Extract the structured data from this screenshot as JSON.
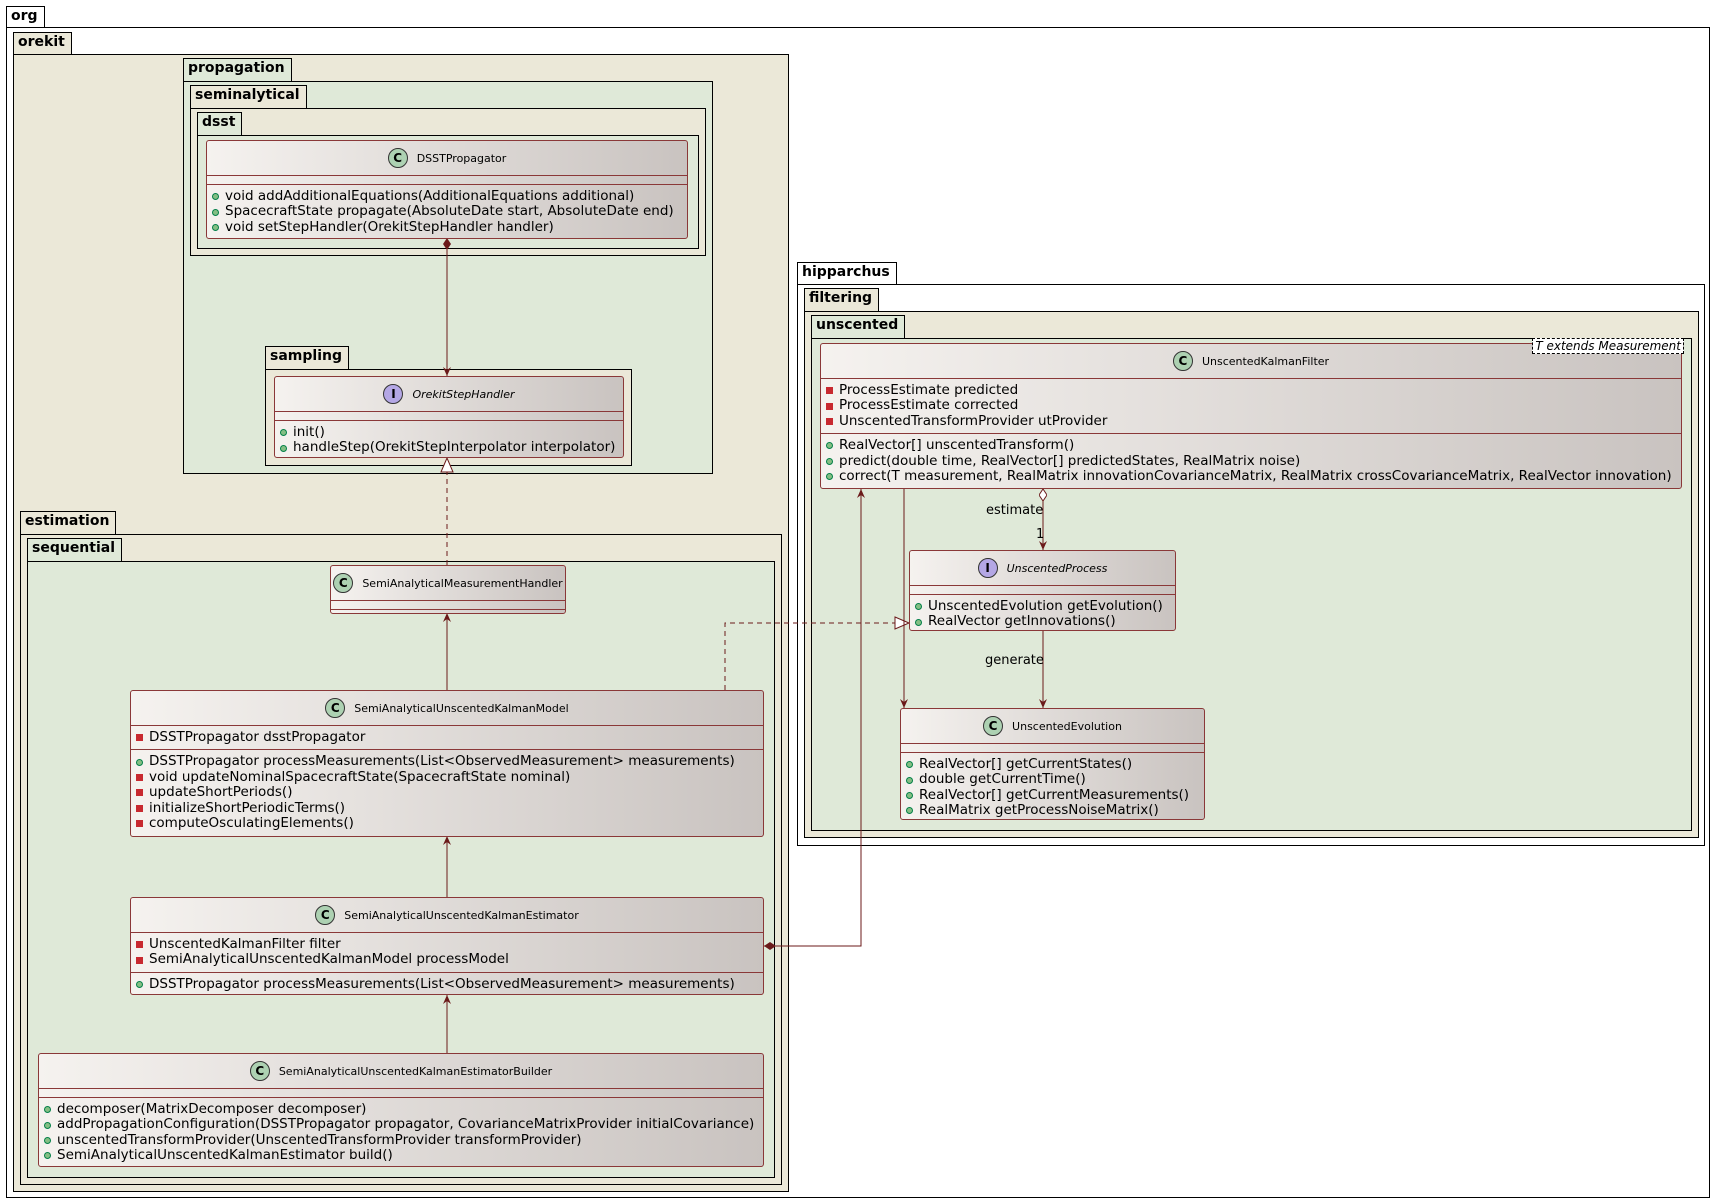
{
  "packages": {
    "org": "org",
    "orekit": "orekit",
    "propagation": "propagation",
    "seminalytical": "seminalytical",
    "dsst": "dsst",
    "sampling": "sampling",
    "estimation": "estimation",
    "sequential": "sequential",
    "hipparchus": "hipparchus",
    "filtering": "filtering",
    "unscented": "unscented"
  },
  "classes": {
    "dsst_propagator": {
      "name": "DSSTPropagator",
      "methods": [
        "void addAdditionalEquations(AdditionalEquations additional)",
        "SpacecraftState propagate(AbsoluteDate start, AbsoluteDate end)",
        "void setStepHandler(OrekitStepHandler handler)"
      ]
    },
    "orekit_step_handler": {
      "name": "OrekitStepHandler",
      "methods": [
        "init()",
        "handleStep(OrekitStepInterpolator interpolator)"
      ]
    },
    "semi_analytical_measurement_handler": {
      "name": "SemiAnalyticalMeasurementHandler"
    },
    "semi_analytical_ukf_model": {
      "name": "SemiAnalyticalUnscentedKalmanModel",
      "fields": [
        "DSSTPropagator dsstPropagator"
      ],
      "methods": [
        "DSSTPropagator processMeasurements(List<ObservedMeasurement> measurements)",
        "void updateNominalSpacecraftState(SpacecraftState nominal)",
        "updateShortPeriods()",
        "initializeShortPeriodicTerms()",
        "computeOsculatingElements()"
      ]
    },
    "semi_analytical_ukf_estimator": {
      "name": "SemiAnalyticalUnscentedKalmanEstimator",
      "fields": [
        "UnscentedKalmanFilter filter",
        "SemiAnalyticalUnscentedKalmanModel processModel"
      ],
      "methods": [
        "DSSTPropagator processMeasurements(List<ObservedMeasurement> measurements)"
      ]
    },
    "semi_analytical_ukf_estimator_builder": {
      "name": "SemiAnalyticalUnscentedKalmanEstimatorBuilder",
      "methods": [
        "decomposer(MatrixDecomposer decomposer)",
        "addPropagationConfiguration(DSSTPropagator propagator, CovarianceMatrixProvider initialCovariance)",
        "unscentedTransformProvider(UnscentedTransformProvider transformProvider)",
        "SemiAnalyticalUnscentedKalmanEstimator build()"
      ]
    },
    "unscented_kalman_filter": {
      "name": "UnscentedKalmanFilter",
      "type_param": "T extends Measurement",
      "fields": [
        "ProcessEstimate predicted",
        "ProcessEstimate corrected",
        "UnscentedTransformProvider utProvider"
      ],
      "methods": [
        "RealVector[] unscentedTransform()",
        "predict(double time, RealVector[] predictedStates, RealMatrix noise)",
        "correct(T measurement, RealMatrix innovationCovarianceMatrix, RealMatrix crossCovarianceMatrix, RealVector innovation)"
      ]
    },
    "unscented_process": {
      "name": "UnscentedProcess",
      "methods": [
        "UnscentedEvolution getEvolution()",
        "RealVector getInnovations()"
      ]
    },
    "unscented_evolution": {
      "name": "UnscentedEvolution",
      "methods": [
        "RealVector[] getCurrentStates()",
        "double getCurrentTime()",
        "RealVector[] getCurrentMeasurements()",
        "RealMatrix getProcessNoiseMatrix()"
      ]
    }
  },
  "edge_labels": {
    "estimate": "estimate",
    "multiplicity_one": "1",
    "generate": "generate"
  },
  "colors": {
    "package_outer": "#ebe8d8",
    "package_inner": "#dfe9d8",
    "edge": "#6b1a1a",
    "class_border": "#8a3838"
  }
}
